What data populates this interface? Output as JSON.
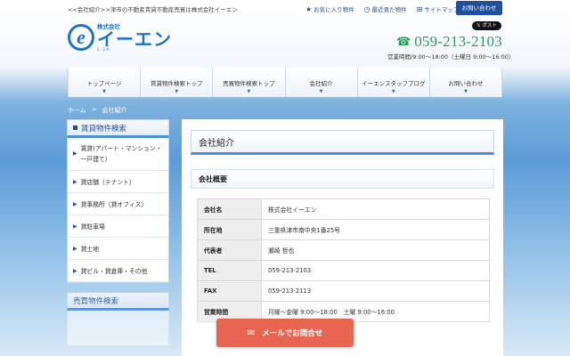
{
  "header": {
    "caption": "<<会社紹介>>津市の不動産賃貸不動産売買は株式会社イーエン",
    "links": [
      {
        "icon": "star-icon",
        "glyph": "★",
        "label": "お気に入り物件"
      },
      {
        "icon": "clock-icon",
        "glyph": "◷",
        "label": "最近見た物件"
      },
      {
        "icon": "sitemap-icon",
        "glyph": "⊞",
        "label": "サイトマップ"
      }
    ],
    "contact_label": "お問い合わせ",
    "x_post": "𝕏 ポスト",
    "logo": {
      "small": "株式会社",
      "mark": "e",
      "name": "イーエン",
      "sub": "E-EN"
    },
    "phone": "059-213-2103",
    "hours": "営業時間/9:00～18:00（土曜日 9:00～16:00）"
  },
  "nav": [
    {
      "label": "トップページ"
    },
    {
      "label": "賃貸物件検索トップ"
    },
    {
      "label": "売買物件検索トップ"
    },
    {
      "label": "会社紹介"
    },
    {
      "label": "イーエンスタッフブログ"
    },
    {
      "label": "お問い合わせ"
    }
  ],
  "breadcrumb": {
    "home": "ホーム",
    "sep": ">",
    "current": "会社紹介"
  },
  "sidebar": {
    "title": "賃貸物件検索",
    "items": [
      {
        "label": "賃貸(アパート・マンション・一戸建て)"
      },
      {
        "label": "貸店舗（テナント）"
      },
      {
        "label": "貸事務所（貸オフィス）"
      },
      {
        "label": "貸駐車場"
      },
      {
        "label": "貸土地"
      },
      {
        "label": "貸ビル・貸倉庫・その他"
      }
    ],
    "title2": "売買物件検索"
  },
  "main": {
    "page_title": "会社紹介",
    "section_title": "会社概要",
    "rows": [
      {
        "k": "会社名",
        "v": "株式会社イーエン"
      },
      {
        "k": "所在地",
        "v": "三重県津市南中央1番25号"
      },
      {
        "k": "代表者",
        "v": "瀬崎 哲也"
      },
      {
        "k": "TEL",
        "v": "059-213-2103"
      },
      {
        "k": "FAX",
        "v": "059-213-2113"
      },
      {
        "k": "営業時間",
        "v": "月曜～金曜 9:00～18:00　土曜 9:00～16:00"
      }
    ]
  },
  "mail_button": {
    "label": "メールでお問合せ"
  }
}
